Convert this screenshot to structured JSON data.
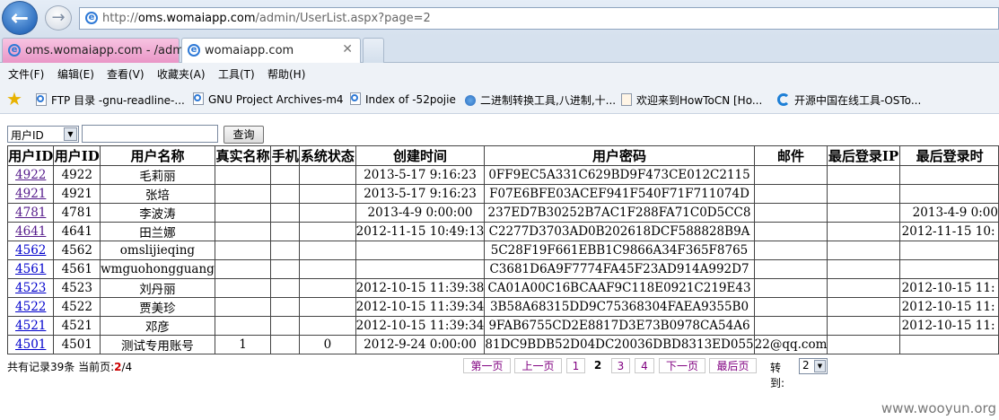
{
  "browser": {
    "address": {
      "scheme": "http://",
      "host": "oms.womaiapp.com",
      "path": "/admin/UserList.aspx?page=2"
    },
    "tabs": [
      {
        "label": "oms.womaiapp.com - /adm..."
      },
      {
        "label": "womaiapp.com"
      }
    ],
    "menu": [
      "文件(F)",
      "编辑(E)",
      "查看(V)",
      "收藏夹(A)",
      "工具(T)",
      "帮助(H)"
    ],
    "favorites": [
      {
        "label": "FTP 目录 -gnu-readline-...",
        "icon": "page-icon"
      },
      {
        "label": "GNU Project Archives-m4",
        "icon": "page-icon"
      },
      {
        "label": "Index of -52pojie",
        "icon": "page-icon"
      },
      {
        "label": "二进制转换工具,八进制,十...",
        "icon": "globe-icon"
      },
      {
        "label": "欢迎来到HowToCN [Ho...",
        "icon": "pen-icon"
      },
      {
        "label": "开源中国在线工具-OSTo...",
        "icon": "c-icon"
      }
    ]
  },
  "search": {
    "field": "用户ID",
    "button": "查询"
  },
  "table": {
    "headers": [
      "用户ID",
      "用户ID",
      "用户名称",
      "真实名称",
      "手机",
      "系统状态",
      "创建时间",
      "用户密码",
      "邮件",
      "最后登录IP",
      "最后登录时"
    ],
    "rows": [
      {
        "link": "4922",
        "id": "4922",
        "name": "毛莉丽",
        "real": "",
        "phone": "",
        "status": "",
        "created": "2013-5-17 9:16:23",
        "pwd": "0FF9EC5A331C629BD9F473CE012C2115",
        "email": "",
        "ip": "",
        "last": ""
      },
      {
        "link": "4921",
        "id": "4921",
        "name": "张培",
        "real": "",
        "phone": "",
        "status": "",
        "created": "2013-5-17 9:16:23",
        "pwd": "F07E6BFE03ACEF941F540F71F711074D",
        "email": "",
        "ip": "",
        "last": ""
      },
      {
        "link": "4781",
        "id": "4781",
        "name": "李波涛",
        "real": "",
        "phone": "",
        "status": "",
        "created": "2013-4-9 0:00:00",
        "pwd": "237ED7B30252B7AC1F288FA71C0D5CC8",
        "email": "",
        "ip": "",
        "last": "2013-4-9 0:00"
      },
      {
        "link": "4641",
        "id": "4641",
        "name": "田兰娜",
        "real": "",
        "phone": "",
        "status": "",
        "created": "2012-11-15 10:49:13",
        "pwd": "C2277D3703AD0B202618DCF588828B9A",
        "email": "",
        "ip": "",
        "last": "2012-11-15 10:"
      },
      {
        "link": "4562",
        "id": "4562",
        "name": "omslijieqing",
        "real": "",
        "phone": "",
        "status": "",
        "created": "",
        "pwd": "5C28F19F661EBB1C9866A34F365F8765",
        "email": "",
        "ip": "",
        "last": ""
      },
      {
        "link": "4561",
        "id": "4561",
        "name": "wmguohongguang",
        "real": "",
        "phone": "",
        "status": "",
        "created": "",
        "pwd": "C3681D6A9F7774FA45F23AD914A992D7",
        "email": "",
        "ip": "",
        "last": ""
      },
      {
        "link": "4523",
        "id": "4523",
        "name": "刘丹丽",
        "real": "",
        "phone": "",
        "status": "",
        "created": "2012-10-15 11:39:38",
        "pwd": "CA01A00C16BCAAF9C118E0921C219E43",
        "email": "",
        "ip": "",
        "last": "2012-10-15 11:"
      },
      {
        "link": "4522",
        "id": "4522",
        "name": "贾美珍",
        "real": "",
        "phone": "",
        "status": "",
        "created": "2012-10-15 11:39:34",
        "pwd": "3B58A68315DD9C75368304FAEA9355B0",
        "email": "",
        "ip": "",
        "last": "2012-10-15 11:"
      },
      {
        "link": "4521",
        "id": "4521",
        "name": "邓彦",
        "real": "",
        "phone": "",
        "status": "",
        "created": "2012-10-15 11:39:34",
        "pwd": "9FAB6755CD2E8817D3E73B0978CA54A6",
        "email": "",
        "ip": "",
        "last": "2012-10-15 11:"
      },
      {
        "link": "4501",
        "id": "4501",
        "name": "测试专用账号",
        "real": "1",
        "phone": "",
        "status": "0",
        "created": "2012-9-24 0:00:00",
        "pwd": "81DC9BDB52D04DC20036DBD8313ED055",
        "email": "22@qq.com",
        "ip": "",
        "last": ""
      }
    ]
  },
  "footer": {
    "total_prefix": "共有记录39条  当前页:",
    "current_page": "2",
    "total_suffix": "/4"
  },
  "pager": {
    "first": "第一页",
    "prev": "上一页",
    "pages": [
      "1",
      "2",
      "3",
      "4"
    ],
    "next": "下一页",
    "last": "最后页",
    "goto_label": "转到:",
    "goto_value": "2"
  },
  "watermark": "www.wooyun.org"
}
